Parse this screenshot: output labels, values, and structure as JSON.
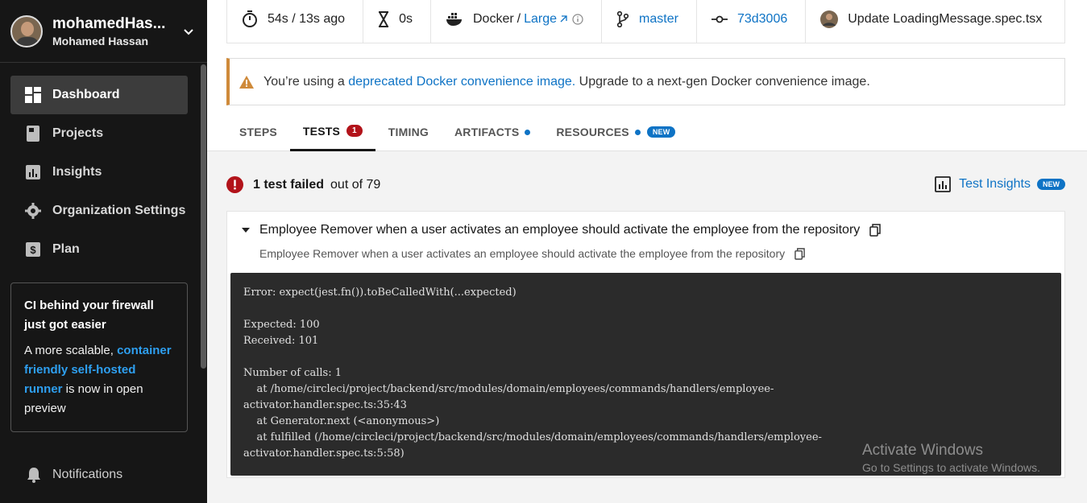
{
  "user": {
    "name": "mohamedHas...",
    "full_name": "Mohamed Hassan"
  },
  "nav": [
    {
      "label": "Dashboard",
      "icon": "dashboard-icon",
      "active": true
    },
    {
      "label": "Projects",
      "icon": "book-icon"
    },
    {
      "label": "Insights",
      "icon": "bar-chart-icon"
    },
    {
      "label": "Organization Settings",
      "icon": "gear-icon"
    },
    {
      "label": "Plan",
      "icon": "dollar-icon"
    }
  ],
  "promo": {
    "title": "CI behind your firewall just got easier",
    "body_start": "A more scalable, ",
    "link": "container friendly self-hosted runner",
    "body_end": " is now in open preview"
  },
  "notifications": {
    "label": "Notifications"
  },
  "job_meta": {
    "duration": "54s / 13s ago",
    "queued": "0s",
    "executor": "Docker",
    "executor_size": "Large",
    "branch": "master",
    "commit": "73d3006",
    "commit_message": "Update LoadingMessage.spec.tsx"
  },
  "banner": {
    "prefix": "You’re using a ",
    "link": "deprecated Docker convenience image.",
    "suffix": " Upgrade to a next-gen Docker convenience image."
  },
  "tabs": [
    {
      "label": "STEPS"
    },
    {
      "label": "TESTS",
      "badge": "1",
      "active": true
    },
    {
      "label": "TIMING"
    },
    {
      "label": "ARTIFACTS",
      "dot": true
    },
    {
      "label": "RESOURCES",
      "dot": true,
      "new": "NEW"
    }
  ],
  "summary": {
    "failed": "1 test failed",
    "total": "out of 79"
  },
  "test_insights": {
    "label": "Test Insights",
    "badge": "NEW"
  },
  "test": {
    "title": "Employee Remover when a user activates an employee should activate the employee from the repository",
    "subtitle": "Employee Remover when a user activates an employee should activate the employee from the repository",
    "output": "Error: expect(jest.fn()).toBeCalledWith(...expected)\n\nExpected: 100\nReceived: 101\n\nNumber of calls: 1\n    at /home/circleci/project/backend/src/modules/domain/employees/commands/handlers/employee-\nactivator.handler.spec.ts:35:43\n    at Generator.next (<anonymous>)\n    at fulfilled (/home/circleci/project/backend/src/modules/domain/employees/commands/handlers/employee-\nactivator.handler.spec.ts:5:58)"
  },
  "watermark": {
    "line1": "Activate Windows",
    "line2": "Go to Settings to activate Windows."
  }
}
